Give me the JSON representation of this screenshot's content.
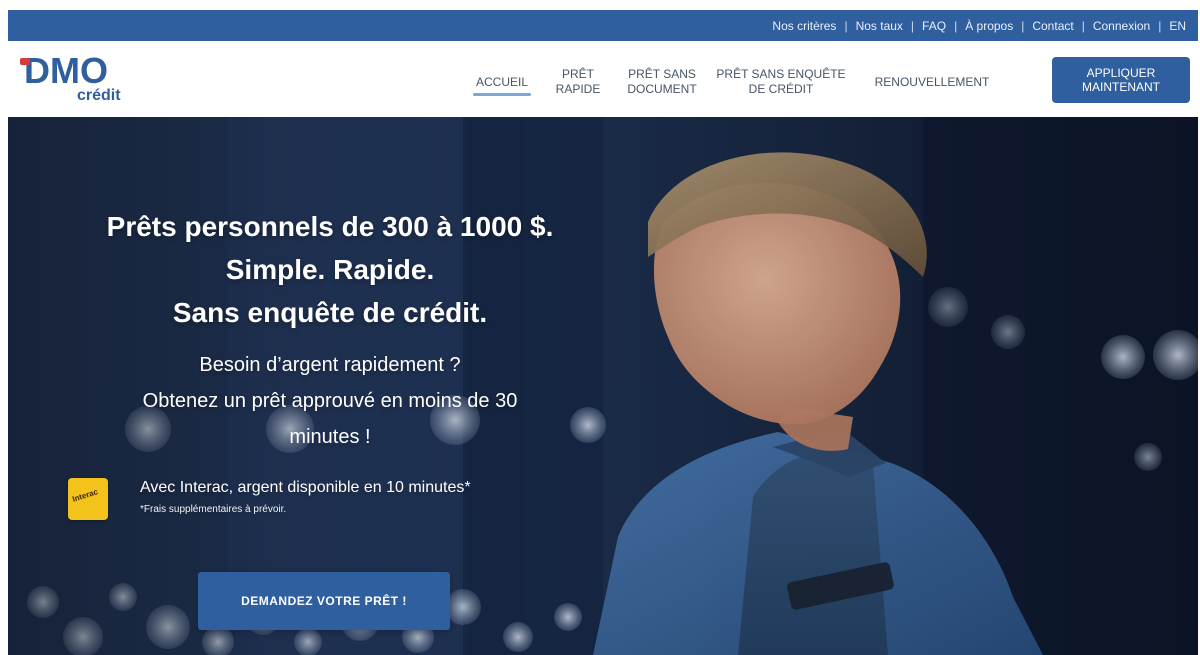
{
  "top_nav": {
    "items": [
      "Nos critères",
      "Nos taux",
      "FAQ",
      "À propos",
      "Contact",
      "Connexion",
      "EN"
    ],
    "separator": "|"
  },
  "header": {
    "logo": {
      "brand": "DMO",
      "subtitle": "crédit"
    },
    "nav": [
      {
        "label": "ACCUEIL",
        "active": true
      },
      {
        "label": "PRÊT RAPIDE",
        "active": false
      },
      {
        "label": "PRÊT SANS DOCUMENT",
        "active": false
      },
      {
        "label": "PRÊT SANS ENQUÊTE DE CRÉDIT",
        "active": false
      },
      {
        "label": "RENOUVELLEMENT",
        "active": false
      }
    ],
    "apply_button": "APPLIQUER MAINTENANT"
  },
  "hero": {
    "headline_lines": [
      "Prêts personnels de 300 à 1000 $.",
      "Simple. Rapide.",
      "Sans enquête de crédit."
    ],
    "subheadline_lines": [
      "Besoin d’argent rapidement ?",
      "Obtenez un prêt approuvé en moins de 30",
      "minutes !"
    ],
    "interac": {
      "badge_text": "Interac",
      "line1": "Avec Interac, argent disponible en 10 minutes*",
      "line2": "*Frais supplémentaires à prévoir."
    },
    "cta_button": "DEMANDEZ VOTRE PRÊT !"
  },
  "colors": {
    "brand_blue": "#2f5f9e",
    "brand_red": "#d8393c",
    "nav_text": "#455566",
    "hero_bg": "#0f1c33",
    "interac_yellow": "#f3c21b"
  }
}
